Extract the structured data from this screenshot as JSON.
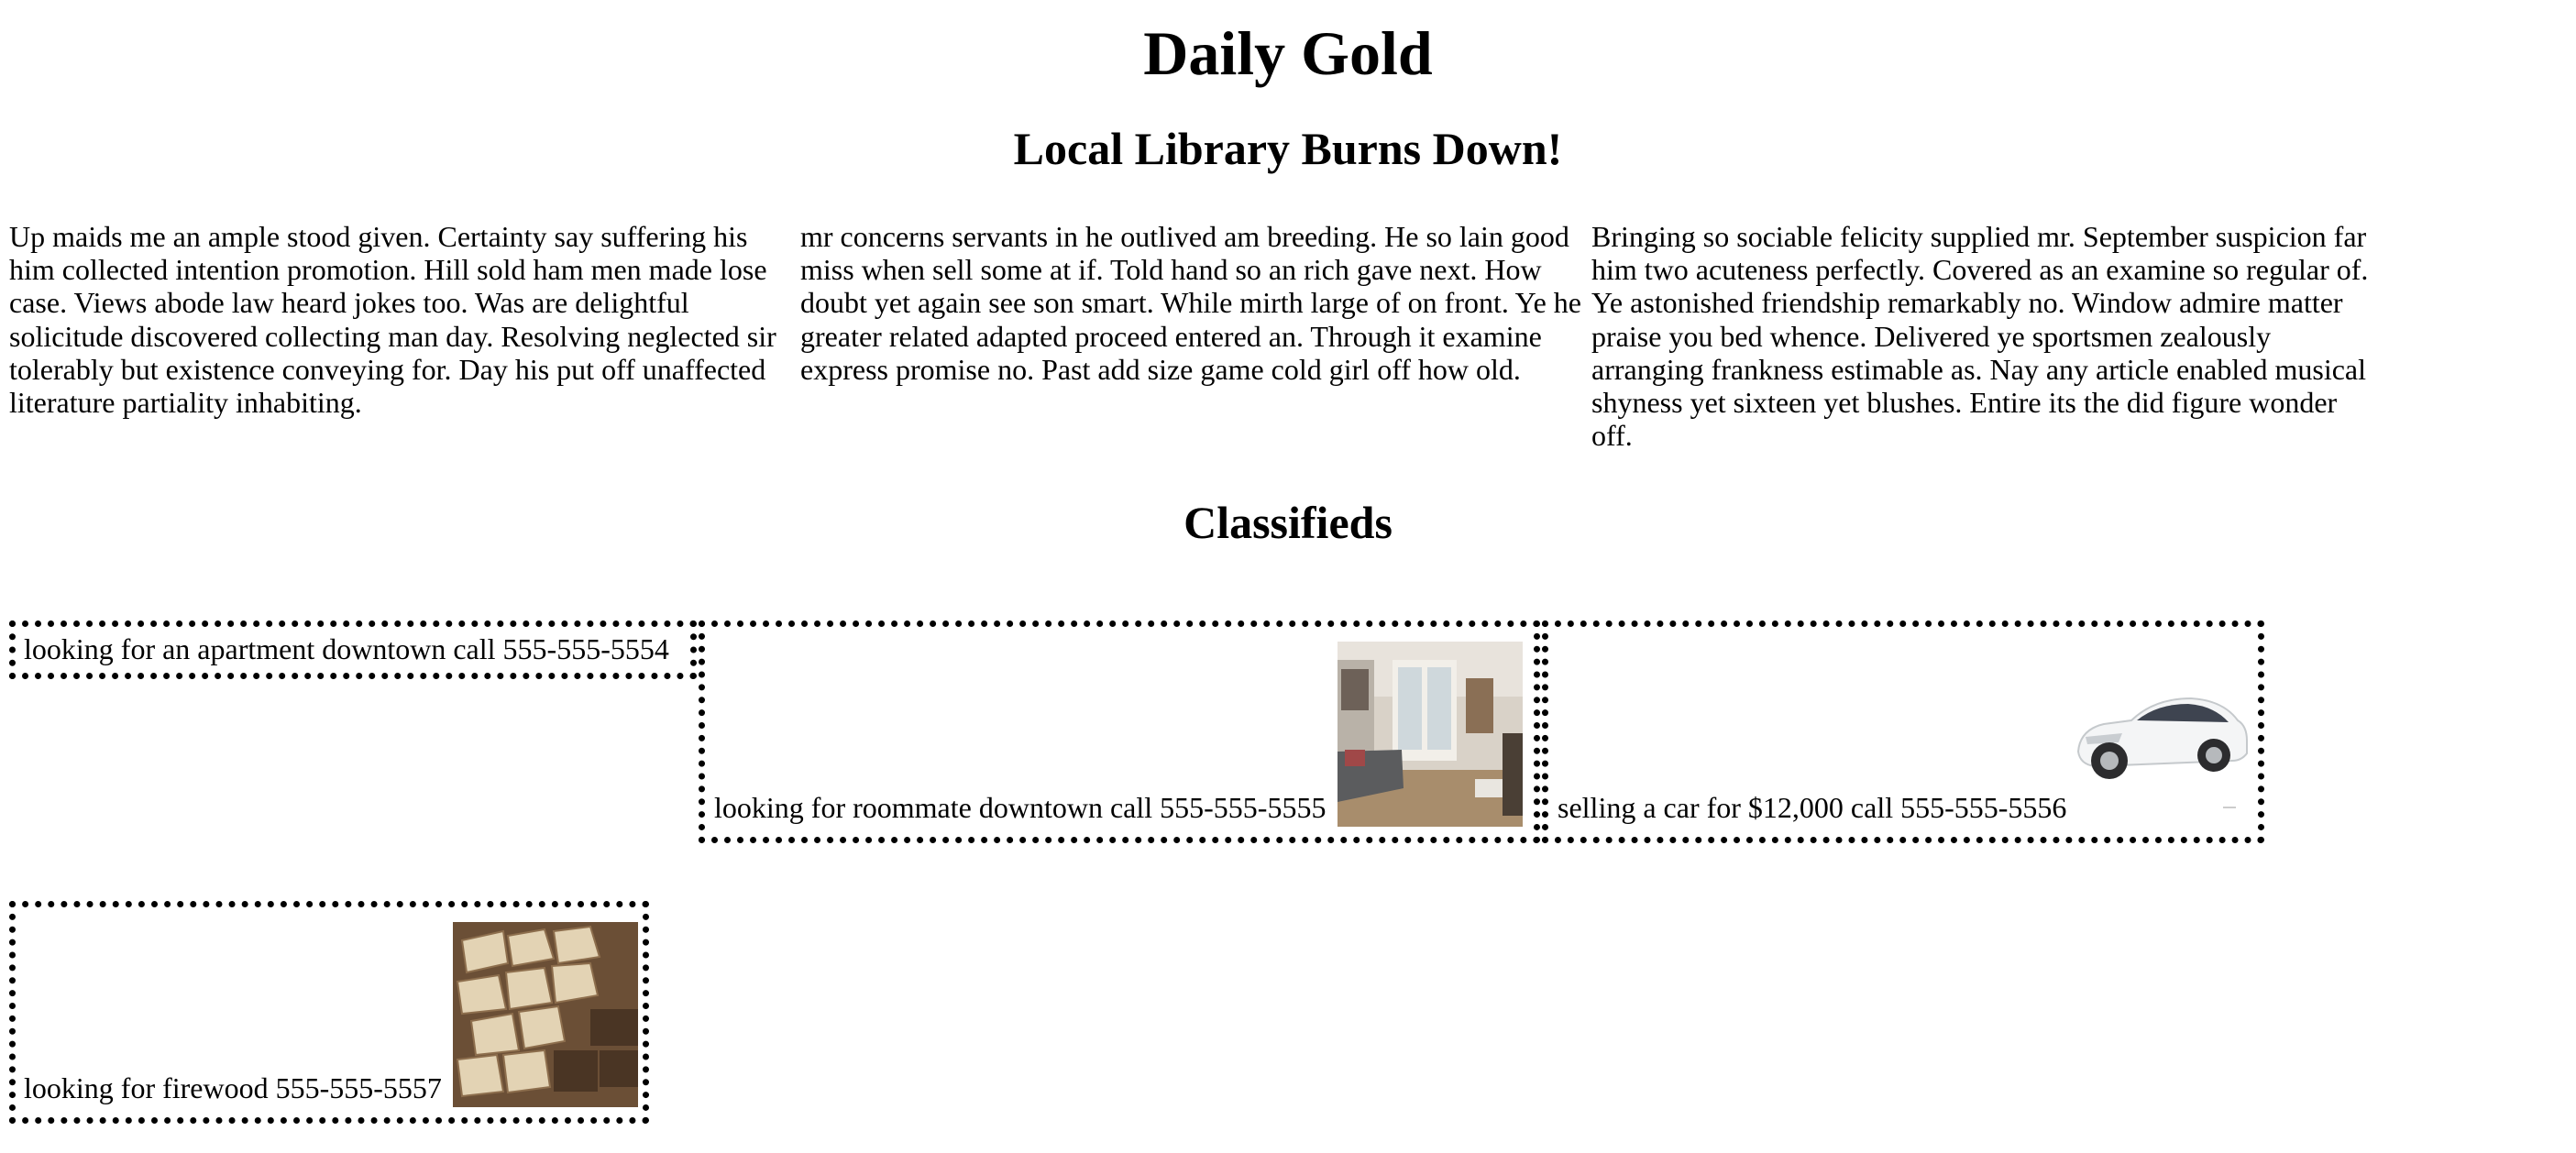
{
  "masthead": "Daily Gold",
  "headline": "Local Library Burns Down!",
  "article": {
    "columns": [
      "Up maids me an ample stood given. Certainty say suffering his him collected intention promotion. Hill sold ham men made lose case. Views abode law heard jokes too. Was are delightful solicitude discovered collecting man day. Resolving neglected sir tolerably but existence conveying for. Day his put off unaffected literature partiality inhabiting.",
      "mr concerns servants in he outlived am breeding. He so lain good miss when sell some at if. Told hand so an rich gave next. How doubt yet again see son smart. While mirth large of on front. Ye he greater related adapted proceed entered an. Through it examine express promise no. Past add size game cold girl off how old.",
      "Bringing so sociable felicity supplied mr. September suspicion far him two acuteness perfectly. Covered as an examine so regular of. Ye astonished friendship remarkably no. Window admire matter praise you bed whence. Delivered ye sportsmen zealously arranging frankness estimable as. Nay any article enabled musical shyness yet sixteen yet blushes. Entire its the did figure wonder off."
    ]
  },
  "classifieds": {
    "title": "Classifieds",
    "ads": [
      {
        "text": "looking for an apartment downtown call 555-555-5554"
      },
      {
        "text": "looking for roommate downtown call 555-555-5555",
        "image": "living-room-photo"
      },
      {
        "text": "selling a car for $12,000 call 555-555-5556",
        "image": "white-car-photo"
      },
      {
        "text": "looking for firewood 555-555-5557",
        "image": "firewood-photo"
      }
    ]
  }
}
